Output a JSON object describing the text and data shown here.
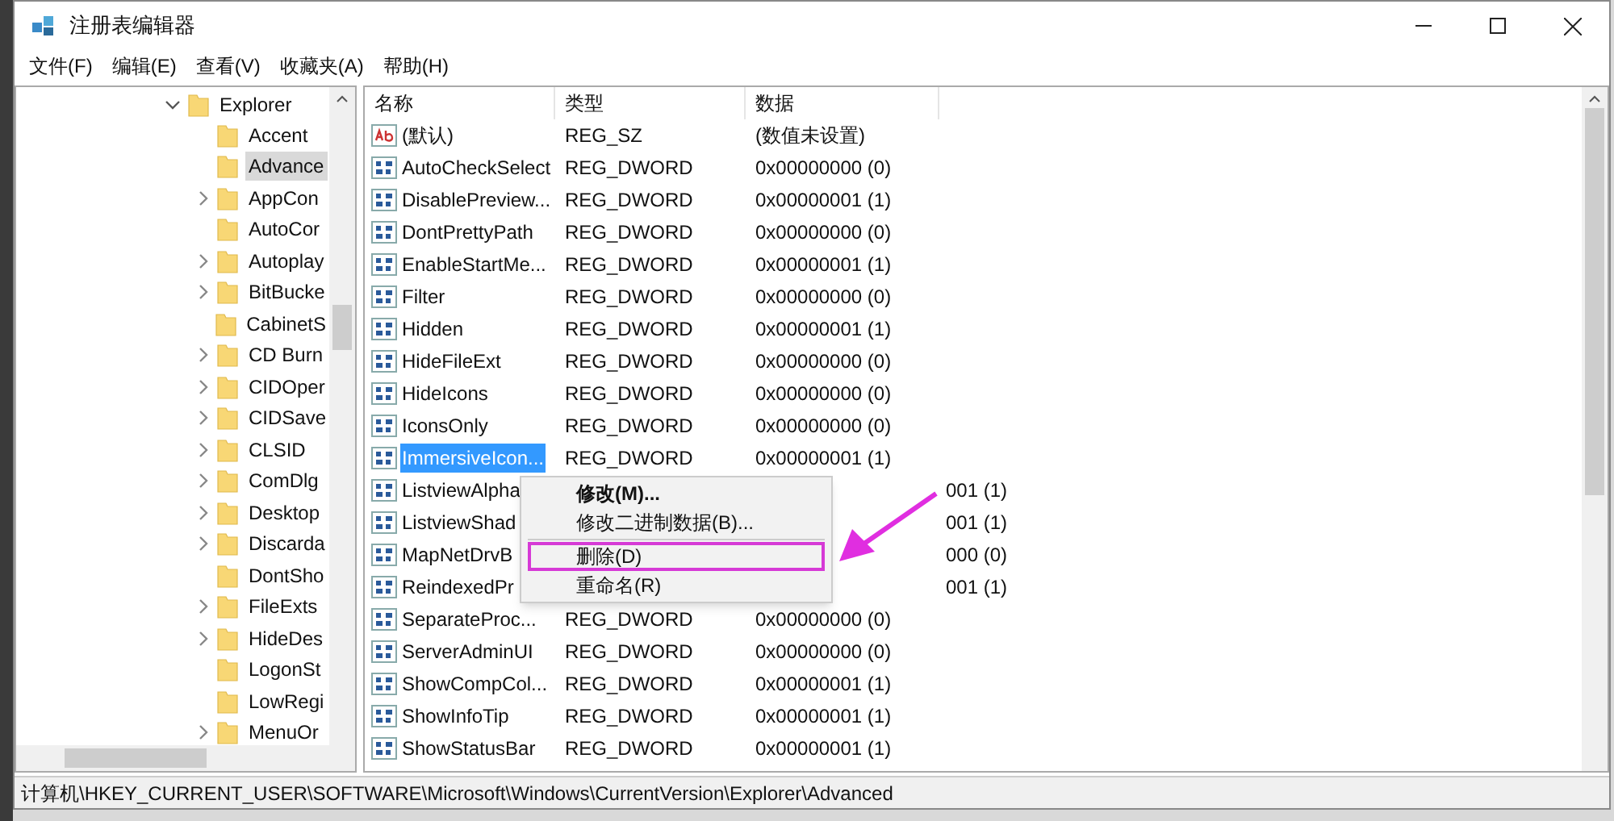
{
  "window": {
    "title": "注册表编辑器"
  },
  "menu_bar": [
    "文件(F)",
    "编辑(E)",
    "查看(V)",
    "收藏夹(A)",
    "帮助(H)"
  ],
  "tree": [
    {
      "label": "Explorer",
      "expanded": true,
      "selected": false,
      "children": [
        {
          "label": "Accent",
          "has_children": false,
          "selected": false
        },
        {
          "label": "Advance",
          "has_children": false,
          "selected": true
        },
        {
          "label": "AppCon",
          "has_children": true,
          "selected": false
        },
        {
          "label": "AutoCor",
          "has_children": false,
          "selected": false
        },
        {
          "label": "Autoplay",
          "has_children": true,
          "selected": false
        },
        {
          "label": "BitBucke",
          "has_children": true,
          "selected": false
        },
        {
          "label": "CabinetS",
          "has_children": false,
          "selected": false
        },
        {
          "label": "CD Burn",
          "has_children": true,
          "selected": false
        },
        {
          "label": "CIDOper",
          "has_children": true,
          "selected": false
        },
        {
          "label": "CIDSave",
          "has_children": true,
          "selected": false
        },
        {
          "label": "CLSID",
          "has_children": true,
          "selected": false
        },
        {
          "label": "ComDlg",
          "has_children": true,
          "selected": false
        },
        {
          "label": "Desktop",
          "has_children": true,
          "selected": false
        },
        {
          "label": "Discarda",
          "has_children": true,
          "selected": false
        },
        {
          "label": "DontSho",
          "has_children": false,
          "selected": false
        },
        {
          "label": "FileExts",
          "has_children": true,
          "selected": false
        },
        {
          "label": "HideDes",
          "has_children": true,
          "selected": false
        },
        {
          "label": "LogonSt",
          "has_children": false,
          "selected": false
        },
        {
          "label": "LowRegi",
          "has_children": false,
          "selected": false
        },
        {
          "label": "MenuOr",
          "has_children": true,
          "selected": false
        }
      ]
    }
  ],
  "table": {
    "columns": [
      "名称",
      "类型",
      "数据"
    ],
    "rows": [
      {
        "kind": "string",
        "name": "(默认)",
        "type": "REG_SZ",
        "data": "(数值未设置)",
        "selected": false
      },
      {
        "kind": "dword",
        "name": "AutoCheckSelect",
        "type": "REG_DWORD",
        "data": "0x00000000 (0)",
        "selected": false
      },
      {
        "kind": "dword",
        "name": "DisablePreview...",
        "type": "REG_DWORD",
        "data": "0x00000001 (1)",
        "selected": false
      },
      {
        "kind": "dword",
        "name": "DontPrettyPath",
        "type": "REG_DWORD",
        "data": "0x00000000 (0)",
        "selected": false
      },
      {
        "kind": "dword",
        "name": "EnableStartMe...",
        "type": "REG_DWORD",
        "data": "0x00000001 (1)",
        "selected": false
      },
      {
        "kind": "dword",
        "name": "Filter",
        "type": "REG_DWORD",
        "data": "0x00000000 (0)",
        "selected": false
      },
      {
        "kind": "dword",
        "name": "Hidden",
        "type": "REG_DWORD",
        "data": "0x00000001 (1)",
        "selected": false
      },
      {
        "kind": "dword",
        "name": "HideFileExt",
        "type": "REG_DWORD",
        "data": "0x00000000 (0)",
        "selected": false
      },
      {
        "kind": "dword",
        "name": "HideIcons",
        "type": "REG_DWORD",
        "data": "0x00000000 (0)",
        "selected": false
      },
      {
        "kind": "dword",
        "name": "IconsOnly",
        "type": "REG_DWORD",
        "data": "0x00000000 (0)",
        "selected": false
      },
      {
        "kind": "dword",
        "name": "ImmersiveIcon...",
        "type": "REG_DWORD",
        "data": "0x00000001 (1)",
        "selected": true
      },
      {
        "kind": "dword",
        "name": "ListviewAlpha",
        "data": "001 (1)",
        "selected": false
      },
      {
        "kind": "dword",
        "name": "ListviewShad",
        "data": "001 (1)",
        "selected": false
      },
      {
        "kind": "dword",
        "name": "MapNetDrvB",
        "data": "000 (0)",
        "selected": false
      },
      {
        "kind": "dword",
        "name": "ReindexedPr",
        "data": "001 (1)",
        "selected": false
      },
      {
        "kind": "dword",
        "name": "SeparateProc...",
        "type": "REG_DWORD",
        "data": "0x00000000 (0)",
        "selected": false
      },
      {
        "kind": "dword",
        "name": "ServerAdminUI",
        "type": "REG_DWORD",
        "data": "0x00000000 (0)",
        "selected": false
      },
      {
        "kind": "dword",
        "name": "ShowCompCol...",
        "type": "REG_DWORD",
        "data": "0x00000001 (1)",
        "selected": false
      },
      {
        "kind": "dword",
        "name": "ShowInfoTip",
        "type": "REG_DWORD",
        "data": "0x00000001 (1)",
        "selected": false
      },
      {
        "kind": "dword",
        "name": "ShowStatusBar",
        "type": "REG_DWORD",
        "data": "0x00000001 (1)",
        "selected": false
      }
    ]
  },
  "context_menu": [
    {
      "label": "修改(M)...",
      "bold": true,
      "highlighted": false
    },
    {
      "label": "修改二进制数据(B)...",
      "bold": false,
      "highlighted": false
    },
    {
      "label": "删除(D)",
      "bold": false,
      "highlighted": true
    },
    {
      "label": "重命名(R)",
      "bold": false,
      "highlighted": false
    }
  ],
  "status_bar": "计算机\\HKEY_CURRENT_USER\\SOFTWARE\\Microsoft\\Windows\\CurrentVersion\\Explorer\\Advanced"
}
